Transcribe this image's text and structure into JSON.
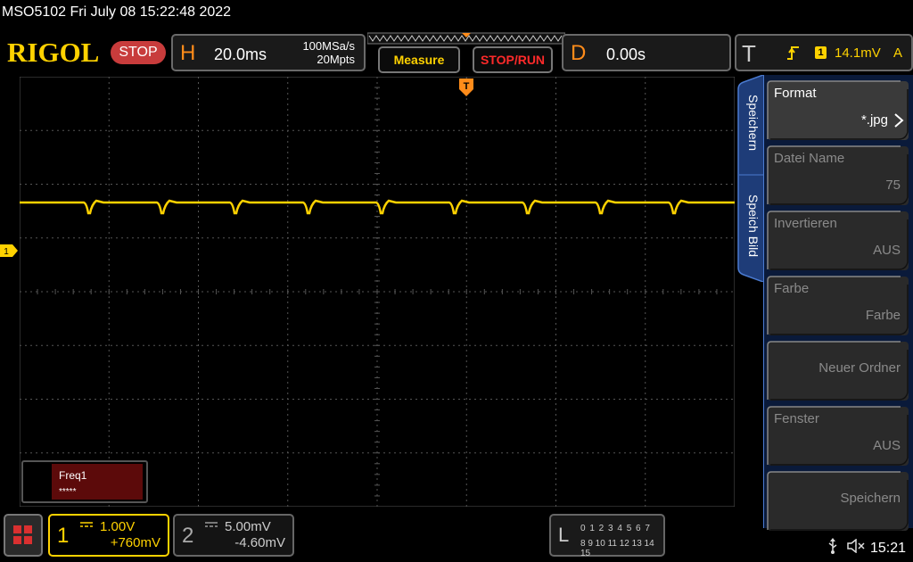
{
  "title": "MSO5102  Fri July 08 15:22:48 2022",
  "logo": "RIGOL",
  "run_state": "STOP",
  "horizontal": {
    "letter": "H",
    "timebase": "20.0ms",
    "sample_rate": "100MSa/s",
    "memory_depth": "20Mpts"
  },
  "buttons": {
    "measure": "Measure",
    "stop_run": "STOP/RUN"
  },
  "delay": {
    "letter": "D",
    "value": "0.00s"
  },
  "trigger": {
    "letter": "T",
    "edge_icon": "rising-edge-icon",
    "channel": "1",
    "level": "14.1mV",
    "mode": "A"
  },
  "channel1_marker": "1",
  "trigger_marker": "T",
  "measurement": {
    "label": "Freq1",
    "value": "*****"
  },
  "side_tabs": {
    "primary": "Speichern",
    "secondary": "Speich Bild"
  },
  "side_menu": [
    {
      "label": "Format",
      "value": "*.jpg",
      "enabled": true,
      "has_arrow": true
    },
    {
      "label": "Datei Name",
      "value": "75",
      "enabled": false,
      "has_arrow": false
    },
    {
      "label": "Invertieren",
      "value": "AUS",
      "enabled": false,
      "has_arrow": false
    },
    {
      "label": "Farbe",
      "value": "Farbe",
      "enabled": false,
      "has_arrow": false
    },
    {
      "label": "",
      "value": "Neuer Ordner",
      "enabled": false,
      "has_arrow": false
    },
    {
      "label": "Fenster",
      "value": "AUS",
      "enabled": false,
      "has_arrow": false
    },
    {
      "label": "",
      "value": "Speichern",
      "enabled": false,
      "has_arrow": false
    }
  ],
  "channel1": {
    "number": "1",
    "coupling_icon": "dc-coupling-icon",
    "scale": "1.00V",
    "offset": "+760mV",
    "color": "#ffd200"
  },
  "channel2": {
    "number": "2",
    "coupling_icon": "dc-coupling-icon",
    "scale": "5.00mV",
    "offset": "-4.60mV",
    "color": "#888888"
  },
  "logic": {
    "letter": "L",
    "row1": "0 1 2 3  4 5 6 7",
    "row2": "8 9 10 11 12 13 14 15"
  },
  "status": {
    "usb_icon": "usb-icon",
    "speaker_icon": "speaker-muted-icon",
    "time": "15:21"
  },
  "colors": {
    "trace": "#ffd200",
    "accent_orange": "#ff8c1a",
    "stop_red": "#c83c3c",
    "panel_blue": "#1e3c78"
  }
}
